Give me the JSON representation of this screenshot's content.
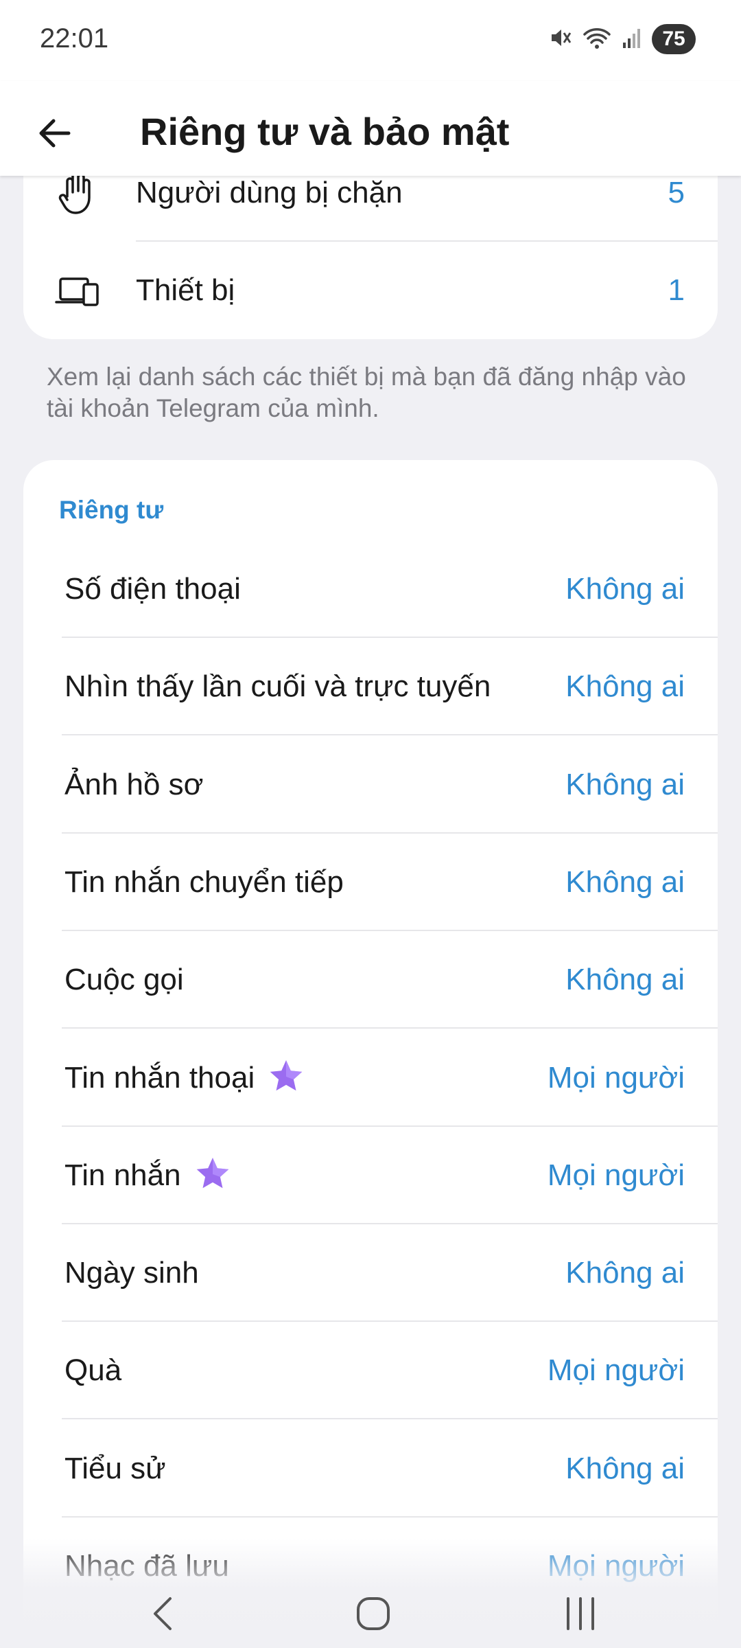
{
  "status_bar": {
    "time": "22:01",
    "battery": "75",
    "icons": [
      "mute-icon",
      "wifi-icon",
      "signal-icon",
      "battery-icon"
    ]
  },
  "app_bar": {
    "title": "Riêng tư và bảo mật",
    "back_icon": "arrow-left-icon"
  },
  "security_items": [
    {
      "label": "Người dùng bị chặn",
      "value": "5",
      "icon": "hand-icon"
    },
    {
      "label": "Thiết bị",
      "value": "1",
      "icon": "devices-icon"
    }
  ],
  "devices_hint": "Xem lại danh sách các thiết bị mà bạn đã đăng nhập vào tài khoản Telegram của mình.",
  "privacy": {
    "section_title": "Riêng tư",
    "items": [
      {
        "label": "Số điện thoại",
        "value": "Không ai",
        "premium": false
      },
      {
        "label": "Nhìn thấy lần cuối và trực tuyến",
        "value": "Không ai",
        "premium": false
      },
      {
        "label": "Ảnh hồ sơ",
        "value": "Không ai",
        "premium": false
      },
      {
        "label": "Tin nhắn chuyển tiếp",
        "value": "Không ai",
        "premium": false
      },
      {
        "label": "Cuộc gọi",
        "value": "Không ai",
        "premium": false
      },
      {
        "label": "Tin nhắn thoại",
        "value": "Mọi người",
        "premium": true
      },
      {
        "label": "Tin nhắn",
        "value": "Mọi người",
        "premium": true
      },
      {
        "label": "Ngày sinh",
        "value": "Không ai",
        "premium": false
      },
      {
        "label": "Quà",
        "value": "Mọi người",
        "premium": false
      },
      {
        "label": "Tiểu sử",
        "value": "Không ai",
        "premium": false
      },
      {
        "label": "Nhạc đã lưu",
        "value": "Mọi người",
        "premium": false
      }
    ]
  },
  "colors": {
    "accent": "#2f8ad0",
    "premium_star": "#9b6cf0",
    "background": "#f0f0f4"
  },
  "nav_bar": {
    "icons": [
      "nav-back-icon",
      "nav-home-icon",
      "nav-recents-icon"
    ]
  }
}
